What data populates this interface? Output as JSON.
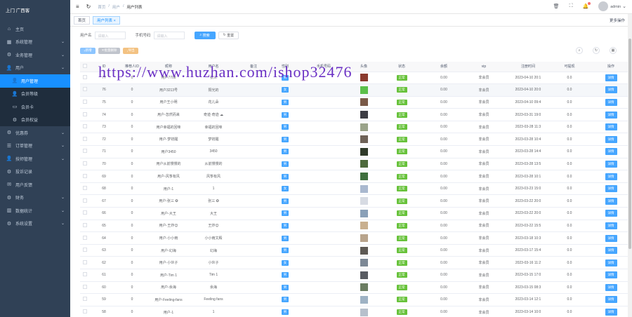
{
  "sidebar": {
    "title": "上门 广西客",
    "items": [
      {
        "label": "主页",
        "icon": "home-icon",
        "chevron": false
      },
      {
        "label": "系统管理",
        "icon": "grid-icon",
        "chevron": true
      },
      {
        "label": "业务管理",
        "icon": "gear-icon",
        "chevron": true
      },
      {
        "label": "用户",
        "icon": "user-icon",
        "chevron": true
      }
    ],
    "sub_items": [
      {
        "label": "用户管理",
        "icon": "user-icon",
        "active": true
      },
      {
        "label": "会员等级",
        "icon": "user-icon",
        "active": false
      },
      {
        "label": "会员卡",
        "icon": "card-icon",
        "active": false
      },
      {
        "label": "会员权益",
        "icon": "gear-icon",
        "active": false
      }
    ],
    "items2": [
      {
        "label": "优惠券",
        "icon": "gear-icon",
        "chevron": true
      },
      {
        "label": "订单管理",
        "icon": "list-icon",
        "chevron": true
      },
      {
        "label": "技师管理",
        "icon": "user-icon",
        "chevron": true
      },
      {
        "label": "投诉记录",
        "icon": "gear-icon",
        "chevron": false
      },
      {
        "label": "用户反馈",
        "icon": "message-icon",
        "chevron": false
      },
      {
        "label": "财务",
        "icon": "gear-icon",
        "chevron": true
      },
      {
        "label": "数据统计",
        "icon": "chart-icon",
        "chevron": true
      },
      {
        "label": "系统设置",
        "icon": "gear-icon",
        "chevron": true
      }
    ]
  },
  "header": {
    "breadcrumb": [
      "首页",
      "用户",
      "用户列表"
    ],
    "user_name": "admin"
  },
  "tags": {
    "items": [
      "首页",
      "用户列表"
    ],
    "more": "更多操作"
  },
  "search": {
    "label1": "用户名",
    "placeholder1": "请输入",
    "label2": "手机号码",
    "placeholder2": "请输入",
    "search_button": "搜索",
    "reset_button": "重置"
  },
  "toolbar": {
    "add": "新增",
    "delete": "批量删除",
    "export": "导出"
  },
  "watermark": "https://www.huzhan.com/ishop32476",
  "table": {
    "columns": [
      "ID",
      "推荐人ID",
      "昵称",
      "用户名",
      "备注",
      "性别",
      "手机号码",
      "头像",
      "状态",
      "余额",
      "vip",
      "注册时间",
      "可提现",
      "操作"
    ],
    "rows": [
      {
        "id": "77",
        "ref": "0",
        "nick": "用户7708",
        "user": "张三",
        "note": "",
        "tag": "男",
        "tagc": "blue",
        "phone": "",
        "avc": "#8b3a2e",
        "status": "正常",
        "bal": "0.00",
        "vip": "非会员",
        "time": "2023-04-10 20:1",
        "wd": "0.0",
        "op": "详情",
        "hl": false
      },
      {
        "id": "76",
        "ref": "0",
        "nick": "用户3213号",
        "user": "阳光的",
        "note": "",
        "tag": "女",
        "tagc": "blue",
        "phone": "",
        "avc": "#5bbf4a",
        "status": "正常",
        "bal": "0.00",
        "vip": "非会员",
        "time": "2023-04-10 20:0",
        "wd": "0.0",
        "op": "详情",
        "hl": true
      },
      {
        "id": "75",
        "ref": "0",
        "nick": "用户王小明",
        "user": "花儿朵",
        "note": "",
        "tag": "男",
        "tagc": "blue",
        "phone": "",
        "avc": "#7a5a48",
        "status": "正常",
        "bal": "0.00",
        "vip": "非会员",
        "time": "2023-04-10 09:4",
        "wd": "0.0",
        "op": "详情",
        "hl": false
      },
      {
        "id": "74",
        "ref": "0",
        "nick": "用户-忽然而来",
        "user": "奇迹·奇迹 ☁",
        "note": "",
        "tag": "男",
        "tagc": "blue",
        "phone": "",
        "avc": "#3d3d44",
        "status": "正常",
        "bal": "0.00",
        "vip": "非会员",
        "time": "2023-03-31 19:0",
        "wd": "0.0",
        "op": "详情",
        "hl": false
      },
      {
        "id": "73",
        "ref": "0",
        "nick": "用户幸福的回味",
        "user": "幸福的回味",
        "note": "",
        "tag": "男",
        "tagc": "blue",
        "phone": "",
        "avc": "#9aa38a",
        "status": "正常",
        "bal": "0.00",
        "vip": "非会员",
        "time": "2023-03-28 11:3",
        "wd": "0.0",
        "op": "详情",
        "hl": false
      },
      {
        "id": "72",
        "ref": "0",
        "nick": "用户-梦初醒",
        "user": "梦初醒",
        "note": "",
        "tag": "男",
        "tagc": "blue",
        "phone": "",
        "avc": "#6e6258",
        "status": "正常",
        "bal": "0.00",
        "vip": "非会员",
        "time": "2023-03-28 10:4",
        "wd": "0.0",
        "op": "详情",
        "hl": false
      },
      {
        "id": "71",
        "ref": "0",
        "nick": "用户3450",
        "user": "3450",
        "note": "",
        "tag": "男",
        "tagc": "blue",
        "phone": "",
        "avc": "#2f3a2a",
        "status": "正常",
        "bal": "0.00",
        "vip": "非会员",
        "time": "2023-03-28 14:4",
        "wd": "0.0",
        "op": "详情",
        "hl": false
      },
      {
        "id": "70",
        "ref": "0",
        "nick": "用户从前慢慢的",
        "user": "从前慢慢的",
        "note": "",
        "tag": "男",
        "tagc": "blue",
        "phone": "",
        "avc": "#4d6a3c",
        "status": "正常",
        "bal": "0.00",
        "vip": "非会员",
        "time": "2023-03-28 13:5",
        "wd": "0.0",
        "op": "详情",
        "hl": false
      },
      {
        "id": "69",
        "ref": "0",
        "nick": "用户-风筝有风",
        "user": "风筝有风",
        "note": "",
        "tag": "男",
        "tagc": "blue",
        "phone": "",
        "avc": "#3f6f3e",
        "status": "正常",
        "bal": "0.00",
        "vip": "非会员",
        "time": "2023-03-28 10:1",
        "wd": "0.0",
        "op": "详情",
        "hl": false
      },
      {
        "id": "68",
        "ref": "0",
        "nick": "用户-1",
        "user": "1",
        "note": "",
        "tag": "女",
        "tagc": "blue",
        "phone": "",
        "avc": "#a9b8cf",
        "status": "正常",
        "bal": "0.00",
        "vip": "非会员",
        "time": "2023-03-23 15:0",
        "wd": "0.0",
        "op": "详情",
        "hl": false
      },
      {
        "id": "67",
        "ref": "0",
        "nick": "用户-张三 ✪",
        "user": "张三 ✪",
        "note": "",
        "tag": "男",
        "tagc": "blue",
        "phone": "",
        "avc": "#d7dbe3",
        "status": "正常",
        "bal": "0.00",
        "vip": "非会员",
        "time": "2023-03-22 20:0",
        "wd": "0.0",
        "op": "详情",
        "hl": false
      },
      {
        "id": "66",
        "ref": "0",
        "nick": "用户-大王",
        "user": "大王",
        "note": "",
        "tag": "男",
        "tagc": "blue",
        "phone": "",
        "avc": "#8aa0b8",
        "status": "正常",
        "bal": "0.00",
        "vip": "非会员",
        "time": "2023-03-22 20:0",
        "wd": "0.0",
        "op": "详情",
        "hl": false
      },
      {
        "id": "65",
        "ref": "0",
        "nick": "用户-王炸😊",
        "user": "王炸😊",
        "note": "",
        "tag": "男",
        "tagc": "blue",
        "phone": "",
        "avc": "#c9b08f",
        "status": "正常",
        "bal": "0.00",
        "vip": "非会员",
        "time": "2023-03-22 15:5",
        "wd": "0.0",
        "op": "详情",
        "hl": false
      },
      {
        "id": "64",
        "ref": "0",
        "nick": "用户-小小雨",
        "user": "小小雨文殿",
        "note": "",
        "tag": "男",
        "tagc": "blue",
        "phone": "",
        "avc": "#b8a48c",
        "status": "正常",
        "bal": "0.00",
        "vip": "非会员",
        "time": "2023-03-18 10:3",
        "wd": "0.0",
        "op": "详情",
        "hl": false
      },
      {
        "id": "63",
        "ref": "0",
        "nick": "用户-幻海",
        "user": "幻海",
        "note": "",
        "tag": "男",
        "tagc": "blue",
        "phone": "",
        "avc": "#5e5a55",
        "status": "正常",
        "bal": "0.00",
        "vip": "非会员",
        "time": "2023-03-17 15:4",
        "wd": "0.0",
        "op": "详情",
        "hl": false
      },
      {
        "id": "62",
        "ref": "0",
        "nick": "用户-小伙子",
        "user": "小伙子",
        "note": "",
        "tag": "女",
        "tagc": "blue",
        "phone": "",
        "avc": "#7c8896",
        "status": "正常",
        "bal": "0.00",
        "vip": "非会员",
        "time": "2023-03-16 11:2",
        "wd": "0.0",
        "op": "详情",
        "hl": false
      },
      {
        "id": "61",
        "ref": "0",
        "nick": "用户-Tim 1",
        "user": "Tim 1",
        "note": "",
        "tag": "男",
        "tagc": "blue",
        "phone": "",
        "avc": "#595c62",
        "status": "正常",
        "bal": "0.00",
        "vip": "非会员",
        "time": "2023-03-15 17:0",
        "wd": "0.0",
        "op": "详情",
        "hl": false
      },
      {
        "id": "60",
        "ref": "0",
        "nick": "用户-余海",
        "user": "余海",
        "note": "",
        "tag": "男",
        "tagc": "blue",
        "phone": "",
        "avc": "#6b7d62",
        "status": "正常",
        "bal": "0.00",
        "vip": "非会员",
        "time": "2023-03-15 08:3",
        "wd": "0.0",
        "op": "详情",
        "hl": false
      },
      {
        "id": "59",
        "ref": "0",
        "nick": "用户-Feeling-fans",
        "user": "Feeling fans",
        "note": "",
        "tag": "男",
        "tagc": "blue",
        "phone": "",
        "avc": "#9eb2c4",
        "status": "正常",
        "bal": "0.00",
        "vip": "非会员",
        "time": "2023-03-14 12:1",
        "wd": "0.0",
        "op": "详情",
        "hl": false
      },
      {
        "id": "58",
        "ref": "0",
        "nick": "用户-1",
        "user": "1",
        "note": "",
        "tag": "男",
        "tagc": "blue",
        "phone": "",
        "avc": "#b6c0cc",
        "status": "正常",
        "bal": "0.00",
        "vip": "非会员",
        "time": "2023-03-14 10:0",
        "wd": "0.0",
        "op": "详情",
        "hl": false
      }
    ]
  }
}
